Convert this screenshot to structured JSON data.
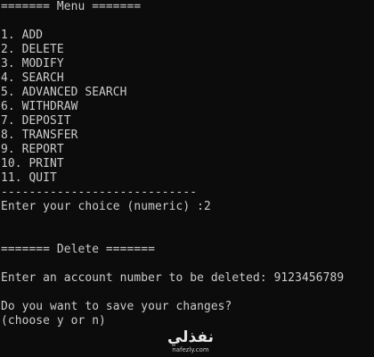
{
  "console": {
    "lines": [
      "======= Menu =======",
      "",
      "1. ADD",
      "2. DELETE",
      "3. MODIFY",
      "4. SEARCH",
      "5. ADVANCED SEARCH",
      "6. WITHDRAW",
      "7. DEPOSIT",
      "8. TRANSFER",
      "9. REPORT",
      "10. PRINT",
      "11. QUIT",
      "----------------------------",
      "Enter your choice (numeric) :2",
      "",
      "",
      "======= Delete =======",
      "",
      "Enter an account number to be deleted: 9123456789",
      "",
      "Do you want to save your changes?",
      "(choose y or n)"
    ],
    "text_color": "#cccccc",
    "background_color": "#0c0c0c"
  },
  "watermark": {
    "arabic": "نفذلي",
    "latin": "nafezly.com"
  }
}
